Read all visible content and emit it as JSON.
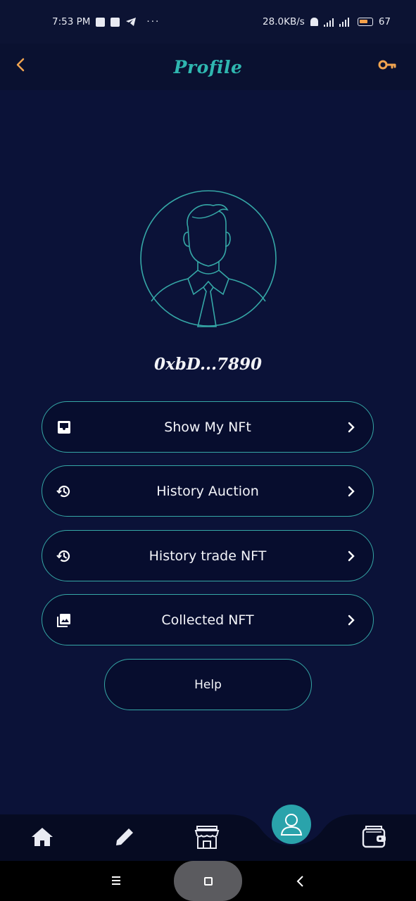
{
  "status_bar": {
    "time": "7:53 PM",
    "more": "···",
    "network_speed": "28.0KB/s",
    "battery": "67"
  },
  "header": {
    "title": "Profile"
  },
  "profile": {
    "wallet_address": "0xbD...7890"
  },
  "menu": [
    {
      "label": "Show My NFt",
      "icon": "inbox-icon"
    },
    {
      "label": "History Auction",
      "icon": "history-icon"
    },
    {
      "label": "History trade NFT",
      "icon": "history-icon"
    },
    {
      "label": "Collected NFT",
      "icon": "photo-library-icon"
    }
  ],
  "help_label": "Help",
  "bottom_nav": {
    "items": [
      "home-icon",
      "edit-icon",
      "store-icon",
      "profile-icon",
      "wallet-icon"
    ],
    "active": "profile-icon"
  },
  "colors": {
    "background": "#0b1238",
    "accent_teal": "#2fb7b0",
    "accent_orange": "#f0a450",
    "button_border": "#35a7a6"
  }
}
